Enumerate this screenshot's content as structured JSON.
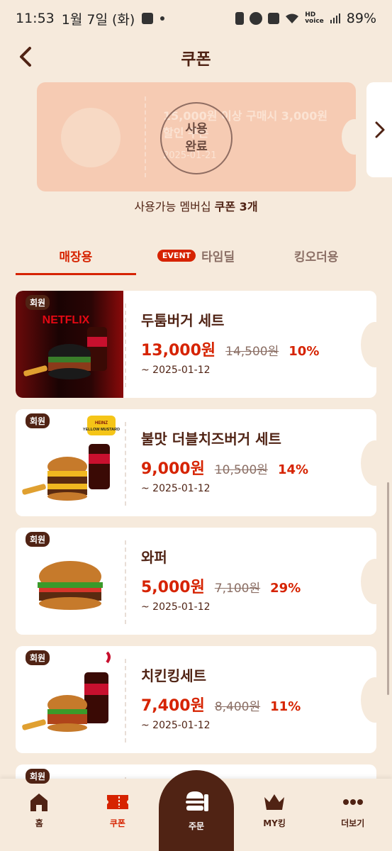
{
  "status_bar": {
    "time": "11:53",
    "date": "1월 7일 (화)",
    "battery": "89%"
  },
  "header": {
    "title": "쿠폰"
  },
  "used_coupon": {
    "name": "15,000원 이상 구매시 3,000원 할인 쿠폰",
    "date": "2025-01-21",
    "stamp_line1": "사용",
    "stamp_line2": "완료"
  },
  "coupon_count": {
    "prefix": "사용가능 멤버십 ",
    "count": "쿠폰 3개"
  },
  "tabs": [
    {
      "label": "매장용"
    },
    {
      "badge": "EVENT",
      "label": "타임딜"
    },
    {
      "label": "킹오더용"
    }
  ],
  "coupons": [
    {
      "badge": "회원",
      "name": "두툼버거 세트",
      "price": "13,000원",
      "original": "14,500원",
      "discount": "10%",
      "expiry": "~ 2025-01-12",
      "image_text": "NETFLIX"
    },
    {
      "badge": "회원",
      "name": "불맛 더블치즈버거 세트",
      "price": "9,000원",
      "original": "10,500원",
      "discount": "14%",
      "expiry": "~ 2025-01-12",
      "image_text": "HEINZ YELLOW MUSTARD"
    },
    {
      "badge": "회원",
      "name": "와퍼",
      "price": "5,000원",
      "original": "7,100원",
      "discount": "29%",
      "expiry": "~ 2025-01-12"
    },
    {
      "badge": "회원",
      "name": "치킨킹세트",
      "price": "7,400원",
      "original": "8,400원",
      "discount": "11%",
      "expiry": "~ 2025-01-12"
    },
    {
      "badge": "회원"
    }
  ],
  "bottom_nav": [
    {
      "label": "홈",
      "icon": "home-icon"
    },
    {
      "label": "쿠폰",
      "icon": "coupon-icon"
    },
    {
      "label": "주문",
      "icon": "burger-icon"
    },
    {
      "label": "MY킹",
      "icon": "crown-icon"
    },
    {
      "label": "더보기",
      "icon": "more-icon"
    }
  ],
  "colors": {
    "background": "#f6eadc",
    "brown": "#502314",
    "red": "#d62300"
  }
}
